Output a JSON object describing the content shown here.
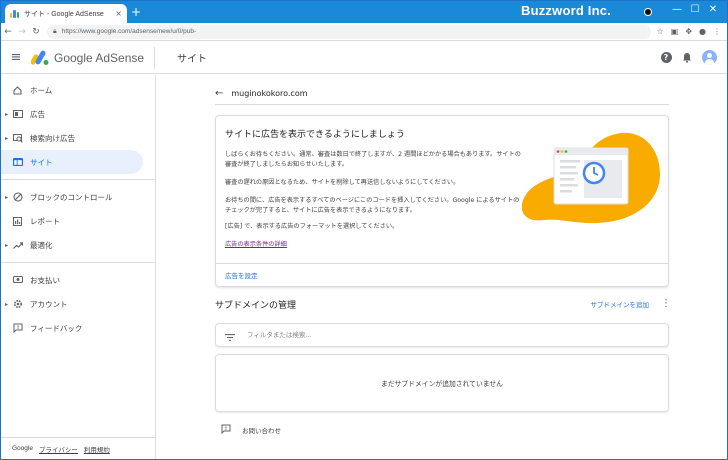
{
  "browser": {
    "tab_title": "サイト - Google AdSense",
    "tab_close": "×",
    "new_tab": "+",
    "url": "https://www.google.com/adsense/new/u/0/pub-",
    "brand": "Buzzword Inc.",
    "window_buttons": [
      "—",
      "☐",
      "✕"
    ]
  },
  "header": {
    "menu": "≡",
    "app_name": "Google AdSense",
    "page_title": "サイト"
  },
  "sidebar": {
    "items": [
      {
        "label": "ホーム",
        "icon": "home-icon"
      },
      {
        "label": "広告",
        "icon": "ads-icon"
      },
      {
        "label": "検索向け広告",
        "icon": "search-ads-icon"
      },
      {
        "label": "サイト",
        "icon": "sites-icon",
        "active": true
      },
      {
        "label": "ブロックのコントロール",
        "icon": "block-icon"
      },
      {
        "label": "レポート",
        "icon": "reports-icon"
      },
      {
        "label": "最適化",
        "icon": "optimize-icon"
      },
      {
        "label": "お支払い",
        "icon": "payments-icon"
      },
      {
        "label": "アカウント",
        "icon": "account-icon"
      },
      {
        "label": "フィードバック",
        "icon": "feedback-icon"
      }
    ],
    "footer": {
      "google": "Google",
      "privacy": "プライバシー",
      "terms": "利用規約"
    }
  },
  "main": {
    "back_arrow": "←",
    "domain": "muginokokoro.com",
    "card": {
      "title": "サイトに広告を表示できるようにしましょう",
      "p1": "しばらくお待ちください。通常、審査は数日で終了しますが、2 週間ほどかかる場合もあります。サイトの審査が終了しましたらお知らせいたします。",
      "p2": "審査の遅れの原因となるため、サイトを削除して再送信しないようにしてください。",
      "p3": "お待ちの間に、広告を表示するすべてのページにこのコードを挿入してください。Google によるサイトのチェックが完了すると、サイトに広告を表示できるようになります。",
      "p4": "[広告] で、表示する広告のフォーマットを選択してください。",
      "link": "広告の表示条件の詳細",
      "action": "広告を設定"
    },
    "subdomains": {
      "title": "サブドメインの管理",
      "add": "サブドメインを追加",
      "filter_placeholder": "フィルタまたは検索...",
      "empty": "まだサブドメインが追加されていません"
    },
    "contact": "お問い合わせ"
  },
  "colors": {
    "accent": "#1a73e8",
    "active_bg": "#e8f0fe",
    "chrome_blue": "#1a8ad8",
    "illustration_yellow": "#f9ab00"
  }
}
